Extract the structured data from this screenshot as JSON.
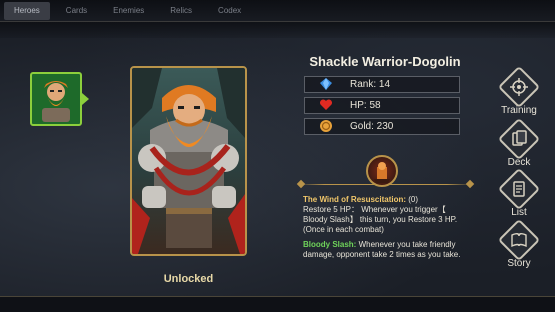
{
  "tabs": [
    {
      "label": "Heroes",
      "active": true
    },
    {
      "label": "Cards",
      "active": false
    },
    {
      "label": "Enemies",
      "active": false
    },
    {
      "label": "Relics",
      "active": false
    },
    {
      "label": "Codex",
      "active": false
    }
  ],
  "hero": {
    "name": "Shackle Warrior-Dogolin",
    "status": "Unlocked"
  },
  "stats": {
    "rank": "Rank: 14",
    "hp": "HP: 58",
    "gold": "Gold: 230"
  },
  "skills": {
    "passive_name": "The Wind of Resuscitation:",
    "passive_extra": " (0)",
    "passive_text": "Restore 5 HP： Whenever you trigger【 Bloody Slash】 this turn, you Restore 3 HP.(Once in each combat)",
    "slash_name": "Bloody Slash:",
    "slash_text": " Whenever you take friendly damage,  opponent take 2 times as you take."
  },
  "side_menu": {
    "training": "Training",
    "deck": "Deck",
    "list": "List",
    "story": "Story"
  },
  "colors": {
    "accent_gold": "#b8934a",
    "selected_green": "#8ccf3c",
    "skill_name_gold": "#f1c76a",
    "skill_name_green": "#6fd35a"
  },
  "icons": {
    "rank": "blue-crystal-icon",
    "hp": "red-heart-icon",
    "gold": "gold-coin-icon",
    "training": "target-icon",
    "deck": "cards-icon",
    "list": "scroll-icon",
    "story": "book-icon"
  }
}
